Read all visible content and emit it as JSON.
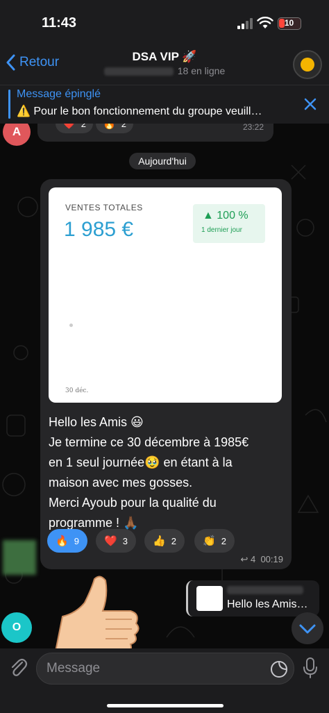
{
  "status_bar": {
    "time": "11:43",
    "battery_level": "10",
    "battery_color": "#ff453a"
  },
  "nav": {
    "back_label": "Retour",
    "title": "DSA VIP 🚀",
    "online_text": "18 en ligne",
    "accent": "#3e93f5"
  },
  "pinned": {
    "title": "Message épinglé",
    "text": "⚠️ Pour le bon fonctionnement du groupe veuill…"
  },
  "previous_message": {
    "avatar_letter": "A",
    "reactions": [
      {
        "emoji": "❤️",
        "count": "2"
      },
      {
        "emoji": "🔥",
        "count": "2"
      }
    ],
    "time": "23:22"
  },
  "date_separator": "Aujourd'hui",
  "message": {
    "stats_card": {
      "label": "VENTES TOTALES",
      "amount": "1 985 €",
      "change": "100 %",
      "change_period": "1 dernier jour",
      "date_label": "30 déc."
    },
    "text_lines": [
      "Hello les Amis 😃",
      "Je termine ce 30 décembre à 1985€",
      "en 1 seul journée🥹 en étant à la",
      "maison avec mes gosses.",
      "Merci Ayoub pour la qualité du",
      "programme ! 🙏🏾"
    ],
    "reactions": [
      {
        "emoji": "🔥",
        "count": "9",
        "selected": true
      },
      {
        "emoji": "❤️",
        "count": "3",
        "selected": false
      },
      {
        "emoji": "👍",
        "count": "2",
        "selected": false
      },
      {
        "emoji": "👏",
        "count": "2",
        "selected": false
      }
    ],
    "replies": "↩ 4",
    "time": "00:19"
  },
  "reply_preview": {
    "text": "Hello les Amis…"
  },
  "next_avatar_letter": "O",
  "input": {
    "placeholder": "Message"
  }
}
